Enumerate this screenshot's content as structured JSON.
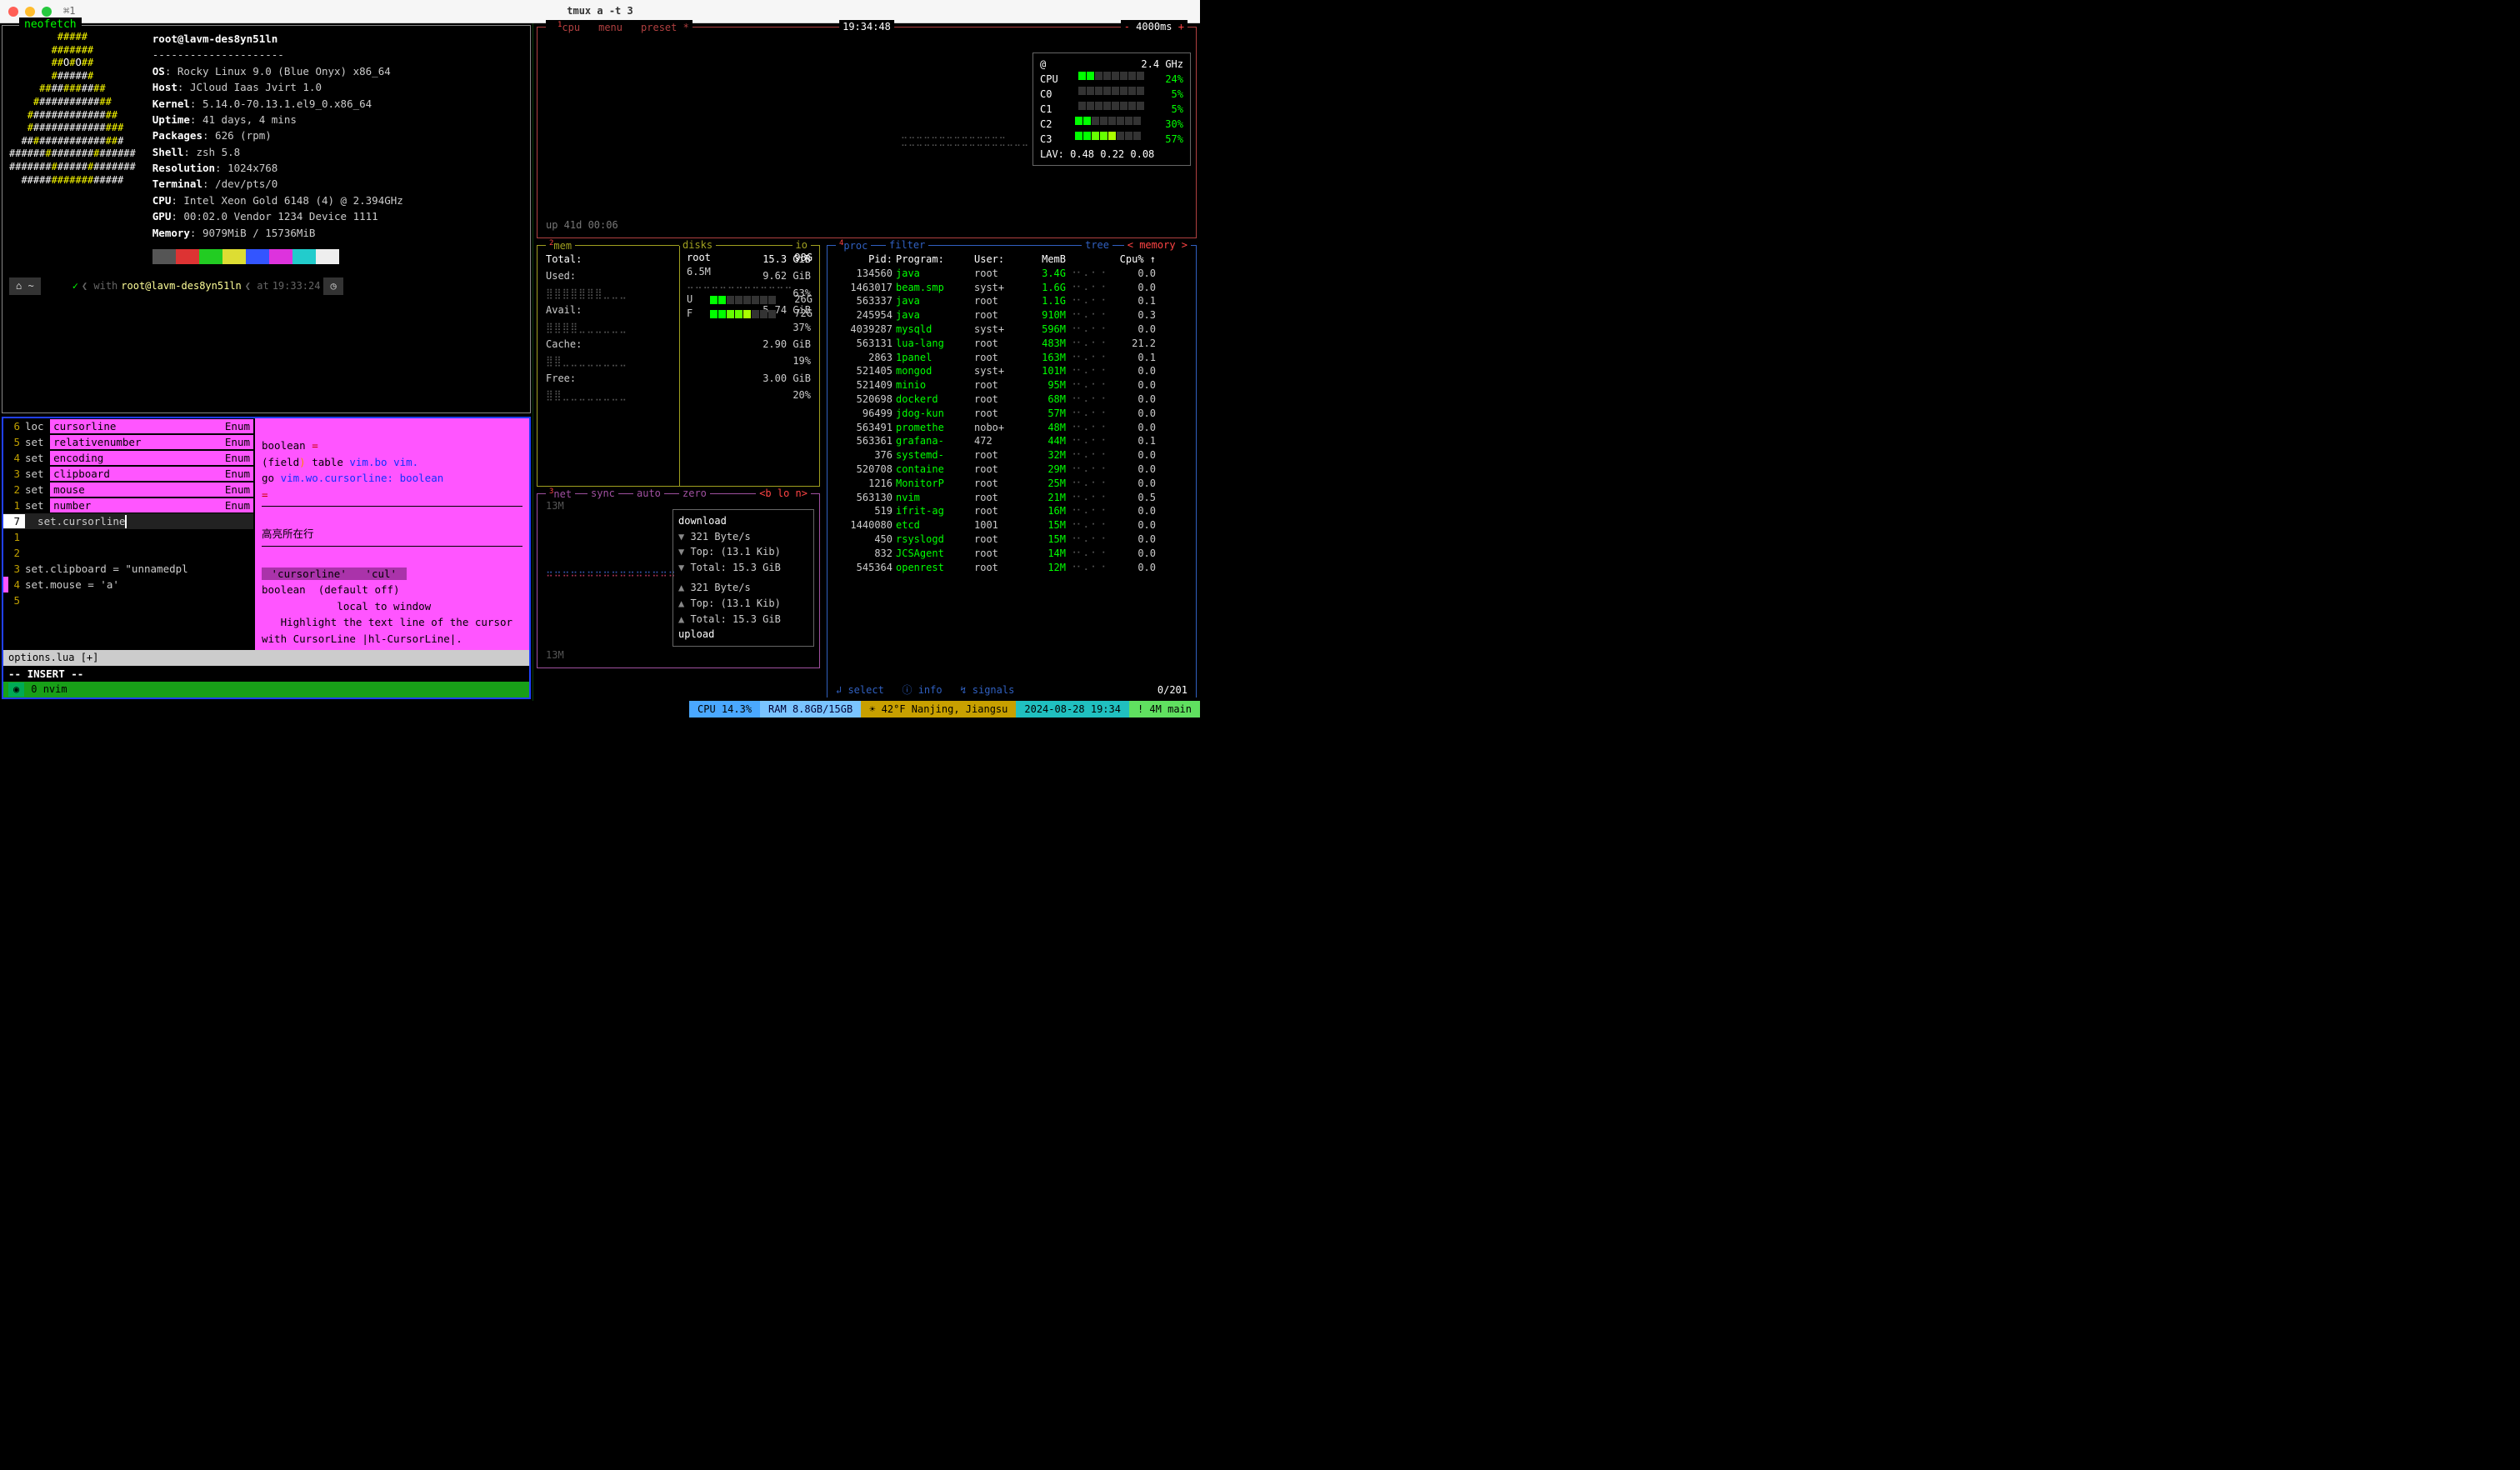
{
  "window": {
    "tab": "⌘1",
    "title": "tmux a -t 3"
  },
  "neofetch": {
    "title": "neofetch",
    "userhost": "root@lavm-des8yn51ln",
    "fields": {
      "os": {
        "k": "OS",
        "v": "Rocky Linux 9.0 (Blue Onyx) x86_64"
      },
      "host": {
        "k": "Host",
        "v": "JCloud Iaas Jvirt 1.0"
      },
      "kernel": {
        "k": "Kernel",
        "v": "5.14.0-70.13.1.el9_0.x86_64"
      },
      "uptime": {
        "k": "Uptime",
        "v": "41 days, 4 mins"
      },
      "packages": {
        "k": "Packages",
        "v": "626 (rpm)"
      },
      "shell": {
        "k": "Shell",
        "v": "zsh 5.8"
      },
      "resolution": {
        "k": "Resolution",
        "v": "1024x768"
      },
      "terminal": {
        "k": "Terminal",
        "v": "/dev/pts/0"
      },
      "cpu": {
        "k": "CPU",
        "v": "Intel Xeon Gold 6148 (4) @ 2.394GHz"
      },
      "gpu": {
        "k": "GPU",
        "v": "00:02.0 Vendor 1234 Device 1111"
      },
      "memory": {
        "k": "Memory",
        "v": "9079MiB / 15736MiB"
      }
    },
    "swatch_colors": [
      "#555",
      "#d33",
      "#2c2",
      "#dd3",
      "#35f",
      "#d3d",
      "#2cc",
      "#eee"
    ],
    "prompt": {
      "with": "with",
      "user": "root@lavm-des8yn51ln",
      "at": "at",
      "time": "19:33:24",
      "tilde": "~"
    }
  },
  "nvim": {
    "lines_above": [
      {
        "n": "6",
        "pre": "loc ",
        "hl": "cursorline",
        "enum": "Enum"
      },
      {
        "n": "5",
        "pre": "set ",
        "hl": "relativenumber",
        "enum": "Enum"
      },
      {
        "n": "4",
        "pre": "set ",
        "hl": "encoding",
        "enum": "Enum"
      },
      {
        "n": "3",
        "pre": "set ",
        "hl": "clipboard",
        "enum": "Enum"
      },
      {
        "n": "2",
        "pre": "set ",
        "hl": "mouse",
        "enum": "Enum"
      },
      {
        "n": "1",
        "pre": "set ",
        "hl": "number",
        "enum": "Enum"
      }
    ],
    "current": {
      "n": "7",
      "text": "  set.cursorline"
    },
    "lines_below": [
      {
        "n": "1",
        "text": ""
      },
      {
        "n": "2",
        "text": ""
      },
      {
        "n": "3",
        "text": "set.clipboard = \"unnamedpl"
      },
      {
        "n": "4",
        "text": "set.mouse = 'a'"
      },
      {
        "n": "5",
        "text": ""
      }
    ],
    "popup": {
      "l1": "boolean ",
      "l2a": "(field",
      "l2b": ")",
      "l2c": " table",
      "l2d": "vim.bo",
      "l2e": "vim.",
      "l3a": "go",
      "l3b": "vim.wo.cursorline: boolean",
      "l4": "=",
      "cn": "高亮所在行",
      "opt": " 'cursorline'   'cul' ",
      "d1": "boolean  (default off)",
      "d2": "            local to window",
      "d3": "   Highlight the text line of the cursor with CursorLine |hl-CursorLine|."
    },
    "status": "options.lua [+]",
    "mode": "-- INSERT --",
    "bottom": {
      "idx": "0",
      "name": "nvim"
    }
  },
  "btop": {
    "cpu": {
      "tabs": {
        "cpu": "cpu",
        "menu": "menu",
        "preset": "preset *"
      },
      "clock": "19:34:48",
      "interval": "4000ms",
      "sup1": "1",
      "minus": "-",
      "plus": "+",
      "freq_label": "@",
      "freq": "2.4 GHz",
      "rows": [
        {
          "name": "CPU",
          "pct": "24%"
        },
        {
          "name": "C0",
          "pct": "5%"
        },
        {
          "name": "C1",
          "pct": "5%"
        },
        {
          "name": "C2",
          "pct": "30%"
        },
        {
          "name": "C3",
          "pct": "57%"
        }
      ],
      "lav": "LAV: 0.48 0.22 0.08",
      "uptime": "up 41d 00:06"
    },
    "mem": {
      "sup": "2",
      "title": "mem",
      "disks": "disks",
      "io": "io",
      "total": {
        "k": "Total:",
        "v": "15.3 GiB"
      },
      "used": {
        "k": "Used:",
        "v": "9.62 GiB",
        "pct": "63%"
      },
      "avail": {
        "k": "Avail:",
        "v": "5.74 GiB",
        "pct": "37%"
      },
      "cache": {
        "k": "Cache:",
        "v": "2.90 GiB",
        "pct": "19%"
      },
      "free": {
        "k": "Free:",
        "v": "3.00 GiB",
        "pct": "20%"
      },
      "disk_root": {
        "name": "root",
        "size": "98G",
        "used": "6.5M"
      },
      "disk_u": {
        "name": "U",
        "val": "26G"
      },
      "disk_f": {
        "name": "F",
        "val": "72G"
      }
    },
    "net": {
      "sup": "3",
      "title": "net",
      "sync": "sync",
      "auto": "auto",
      "zero": "zero",
      "iface": "<b lo n>",
      "left_top": "13M",
      "left_bot": "13M",
      "download": "download",
      "upload": "upload",
      "dn": {
        "rate": "321 Byte/s",
        "top": "Top: (13.1 Kib)",
        "total": "Total: 15.3 GiB"
      },
      "up": {
        "rate": "321 Byte/s",
        "top": "Top: (13.1 Kib)",
        "total": "Total: 15.3 GiB"
      }
    },
    "proc": {
      "sup": "4",
      "title": "proc",
      "filter": "filter",
      "tree": "tree",
      "sort": "< memory >",
      "cols": {
        "pid": "Pid:",
        "prog": "Program:",
        "user": "User:",
        "mem": "MemB",
        "cpu": "Cpu% ↑"
      },
      "rows": [
        {
          "pid": "134560",
          "prog": "java",
          "user": "root",
          "mem": "3.4G",
          "cpu": "0.0"
        },
        {
          "pid": "1463017",
          "prog": "beam.smp",
          "user": "syst+",
          "mem": "1.6G",
          "cpu": "0.0"
        },
        {
          "pid": "563337",
          "prog": "java",
          "user": "root",
          "mem": "1.1G",
          "cpu": "0.1"
        },
        {
          "pid": "245954",
          "prog": "java",
          "user": "root",
          "mem": "910M",
          "cpu": "0.3"
        },
        {
          "pid": "4039287",
          "prog": "mysqld",
          "user": "syst+",
          "mem": "596M",
          "cpu": "0.0"
        },
        {
          "pid": "563131",
          "prog": "lua-lang",
          "user": "root",
          "mem": "483M",
          "cpu": "21.2"
        },
        {
          "pid": "2863",
          "prog": "1panel",
          "user": "root",
          "mem": "163M",
          "cpu": "0.1"
        },
        {
          "pid": "521405",
          "prog": "mongod",
          "user": "syst+",
          "mem": "101M",
          "cpu": "0.0"
        },
        {
          "pid": "521409",
          "prog": "minio",
          "user": "root",
          "mem": "95M",
          "cpu": "0.0"
        },
        {
          "pid": "520698",
          "prog": "dockerd",
          "user": "root",
          "mem": "68M",
          "cpu": "0.0"
        },
        {
          "pid": "96499",
          "prog": "jdog-kun",
          "user": "root",
          "mem": "57M",
          "cpu": "0.0"
        },
        {
          "pid": "563491",
          "prog": "promethe",
          "user": "nobo+",
          "mem": "48M",
          "cpu": "0.0"
        },
        {
          "pid": "563361",
          "prog": "grafana-",
          "user": "472",
          "mem": "44M",
          "cpu": "0.1"
        },
        {
          "pid": "376",
          "prog": "systemd-",
          "user": "root",
          "mem": "32M",
          "cpu": "0.0"
        },
        {
          "pid": "520708",
          "prog": "containe",
          "user": "root",
          "mem": "29M",
          "cpu": "0.0"
        },
        {
          "pid": "1216",
          "prog": "MonitorP",
          "user": "root",
          "mem": "25M",
          "cpu": "0.0"
        },
        {
          "pid": "563130",
          "prog": "nvim",
          "user": "root",
          "mem": "21M",
          "cpu": "0.5"
        },
        {
          "pid": "519",
          "prog": "ifrit-ag",
          "user": "root",
          "mem": "16M",
          "cpu": "0.0"
        },
        {
          "pid": "1440080",
          "prog": "etcd",
          "user": "1001",
          "mem": "15M",
          "cpu": "0.0"
        },
        {
          "pid": "450",
          "prog": "rsyslogd",
          "user": "root",
          "mem": "15M",
          "cpu": "0.0"
        },
        {
          "pid": "832",
          "prog": "JCSAgent",
          "user": "root",
          "mem": "14M",
          "cpu": "0.0"
        },
        {
          "pid": "545364",
          "prog": "openrest",
          "user": "root",
          "mem": "12M",
          "cpu": "0.0"
        }
      ],
      "footer": {
        "select": "↲ select",
        "info": "ⓘ info",
        "signals": "↯ signals",
        "pos": "0/201"
      }
    }
  },
  "statusbar": {
    "cpu": "CPU 14.3%",
    "ram": "RAM 8.8GB/15GB",
    "weather": "☀ 42°F Nanjing, Jiangsu",
    "datetime": "2024-08-28 19:34",
    "right": "! 4M main"
  }
}
